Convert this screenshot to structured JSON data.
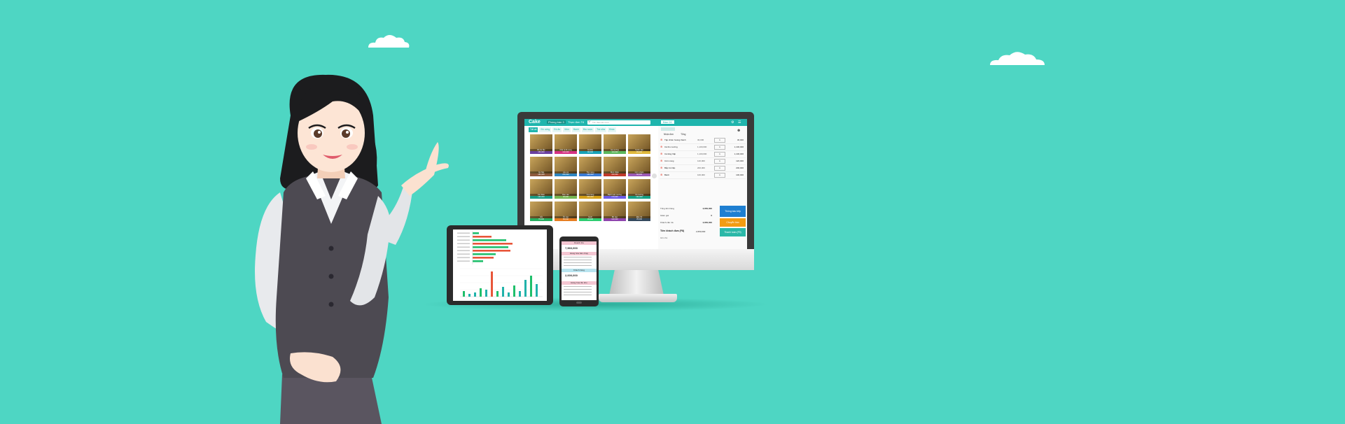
{
  "colors": {
    "background": "#4ed6c3",
    "accent": "#1fb5ad",
    "monitor_bezel": "#3a3a3a",
    "button_blue": "#1e7fd1",
    "button_orange": "#f39c12",
    "button_teal": "#2bb8a8",
    "bar_green": "#1fbf6b",
    "bar_red": "#e8563a",
    "bar_teal": "#20b2aa"
  },
  "pos": {
    "logo": "Cake",
    "location": "Phòng bàn 3",
    "store": "Thực đơn Tủ",
    "search_placeholder": "Tìm theo tên món",
    "category_tabs": [
      "Tất cả",
      "Đồ uống",
      "Đồ ăn",
      "Món",
      "Bánh",
      "Bia rượu",
      "Trà sữa",
      "Khác"
    ],
    "products": [
      {
        "name": "Bò lúc lắc",
        "price": "150,000"
      },
      {
        "name": "Chả cá lã vọng",
        "price": "120,000"
      },
      {
        "name": "Cá kho",
        "price": "90,000"
      },
      {
        "name": "Gà nướng",
        "price": "110,000"
      },
      {
        "name": "Sườn xào",
        "price": "95,000"
      },
      {
        "name": "Cá hấp",
        "price": "180,000"
      },
      {
        "name": "Lẩu cá",
        "price": "250,000"
      },
      {
        "name": "Tôm rang",
        "price": "160,000"
      },
      {
        "name": "Mực chiên",
        "price": "140,000"
      },
      {
        "name": "Cơm chiên",
        "price": "60,000"
      },
      {
        "name": "Cá chiên",
        "price": "130,000"
      },
      {
        "name": "Rau xào",
        "price": "40,000"
      },
      {
        "name": "Cua rang",
        "price": "300,000"
      },
      {
        "name": "Bạch tuộc nướng",
        "price": "170,000"
      },
      {
        "name": "Cá nướng",
        "price": "190,000"
      },
      {
        "name": "Gỏi",
        "price": "70,000"
      },
      {
        "name": "Ốc xào",
        "price": "85,000"
      },
      {
        "name": "Canh",
        "price": "45,000"
      },
      {
        "name": "Bò xào",
        "price": "120,000"
      },
      {
        "name": "Đậu hũ",
        "price": "35,000"
      }
    ],
    "order_tab": "Bàn 01",
    "order_subtabs": [
      "Nhận đơn",
      "Tổng"
    ],
    "order_items": [
      {
        "name": "Tập chiên hoàng thành",
        "price": "30,000",
        "qty": "1",
        "total": "30,000"
      },
      {
        "name": "Cá thu nướng",
        "price": "1,100,000",
        "qty": "1",
        "total": "1,100,000"
      },
      {
        "name": "Cá lăng hấp",
        "price": "1,100,000",
        "qty": "1",
        "total": "1,100,000"
      },
      {
        "name": "Cơm rang",
        "price": "120,000",
        "qty": "1",
        "total": "120,000"
      },
      {
        "name": "Bắp bò hấp",
        "price": "200,000",
        "qty": "1",
        "total": "200,000"
      },
      {
        "name": "Bánh",
        "price": "100,000",
        "qty": "1",
        "total": "100,000"
      }
    ],
    "summary": [
      {
        "label": "Tổng tiền hàng",
        "value": "2,650,000"
      },
      {
        "label": "Giảm giá",
        "value": "0"
      },
      {
        "label": "Khách cần trả",
        "value": "2,650,000"
      }
    ],
    "customer_paid_label": "Tiền khách đưa (F8)",
    "customer_paid_value": "2,650,000",
    "note_label": "Ghi chú",
    "buttons": [
      "Thông báo bếp",
      "Chuyển bàn",
      "Thanh toán (F9)"
    ]
  },
  "tablet": {
    "hbar_values": [
      0.15,
      0.45,
      0.8,
      0.95,
      0.85,
      0.9,
      0.55,
      0.5,
      0.25
    ],
    "vbar_values": [
      0.2,
      0.1,
      0.15,
      0.3,
      0.25,
      0.9,
      0.2,
      0.35,
      0.15,
      0.4,
      0.2,
      0.6,
      0.75,
      0.45
    ]
  },
  "phone": {
    "sections": [
      "Doanh thu",
      "Hàng hóa bán chạy",
      "Khách hàng",
      "Hàng hóa tồn kho"
    ],
    "values": [
      "7,560,000",
      "2,000,000"
    ]
  }
}
